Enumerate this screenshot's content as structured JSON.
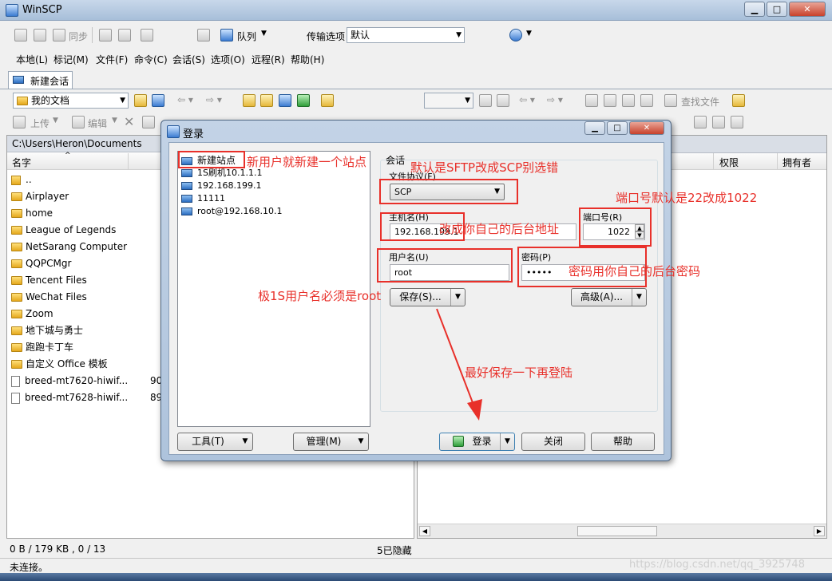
{
  "window": {
    "title": "WinSCP"
  },
  "toolbar1": {
    "sync_label": "同步",
    "queue_label": "队列",
    "transfer_settings_label": "传输选项",
    "transfer_settings_value": "默认"
  },
  "menu": [
    "本地(L)",
    "标记(M)",
    "文件(F)",
    "命令(C)",
    "会话(S)",
    "选项(O)",
    "远程(R)",
    "帮助(H)"
  ],
  "session_tab": {
    "label": "新建会话"
  },
  "local_panel": {
    "location": "我的文档",
    "upload_label": "上传",
    "edit_label": "编辑",
    "path": "C:\\Users\\Heron\\Documents",
    "col_name": "名字",
    "files": [
      {
        "name": "..",
        "kind": "up",
        "size": ""
      },
      {
        "name": "Airplayer",
        "kind": "folder",
        "size": ""
      },
      {
        "name": "home",
        "kind": "folder",
        "size": ""
      },
      {
        "name": "League of Legends",
        "kind": "folder",
        "size": ""
      },
      {
        "name": "NetSarang Computer",
        "kind": "folder",
        "size": ""
      },
      {
        "name": "QQPCMgr",
        "kind": "folder",
        "size": ""
      },
      {
        "name": "Tencent Files",
        "kind": "folder",
        "size": ""
      },
      {
        "name": "WeChat Files",
        "kind": "folder",
        "size": ""
      },
      {
        "name": "Zoom",
        "kind": "folder",
        "size": ""
      },
      {
        "name": "地下城与勇士",
        "kind": "folder",
        "size": ""
      },
      {
        "name": "跑跑卡丁车",
        "kind": "folder",
        "size": ""
      },
      {
        "name": "自定义 Office 模板",
        "kind": "folder",
        "size": ""
      },
      {
        "name": "breed-mt7620-hiwif...",
        "kind": "file",
        "size": "90"
      },
      {
        "name": "breed-mt7628-hiwif...",
        "kind": "file",
        "size": "89"
      }
    ]
  },
  "remote_panel": {
    "find_files_label": "查找文件",
    "col_permissions": "权限",
    "col_owner": "拥有者"
  },
  "status": {
    "left_summary": "0 B / 179 KB ,  0 / 13",
    "hidden_count": "5已隐藏",
    "connection": "未连接。",
    "watermark": "https://blog.csdn.net/qq_3925748"
  },
  "dialog": {
    "title": "登录",
    "sites": [
      {
        "label": "新建站点",
        "kind": "new"
      },
      {
        "label": "1S刷机10.1.1.1",
        "kind": "pc"
      },
      {
        "label": "192.168.199.1",
        "kind": "pc"
      },
      {
        "label": "11111",
        "kind": "pc"
      },
      {
        "label": "root@192.168.10.1",
        "kind": "pc"
      }
    ],
    "session_group": "会话",
    "protocol_label": "文件协议(F)",
    "protocol_value": "SCP",
    "host_label": "主机名(H)",
    "host_value": "192.168.199.1",
    "port_label": "端口号(R)",
    "port_value": "1022",
    "user_label": "用户名(U)",
    "user_value": "root",
    "password_label": "密码(P)",
    "password_value": "•••••",
    "save_label": "保存(S)...",
    "advanced_label": "高级(A)...",
    "tools_label": "工具(T)",
    "manage_label": "管理(M)",
    "login_label": "登录",
    "close_label": "关闭",
    "help_label": "帮助"
  },
  "annotations": {
    "new_site": "新用户就新建一个站点",
    "protocol": "默认是SFTP改成SCP别选错",
    "port": "端口号默认是22改成1022",
    "host": "改成你自己的后台地址",
    "password": "密码用你自己的后台密码",
    "user": "极1S用户名必须是root",
    "save": "最好保存一下再登陆",
    "color": "#e8302a"
  }
}
